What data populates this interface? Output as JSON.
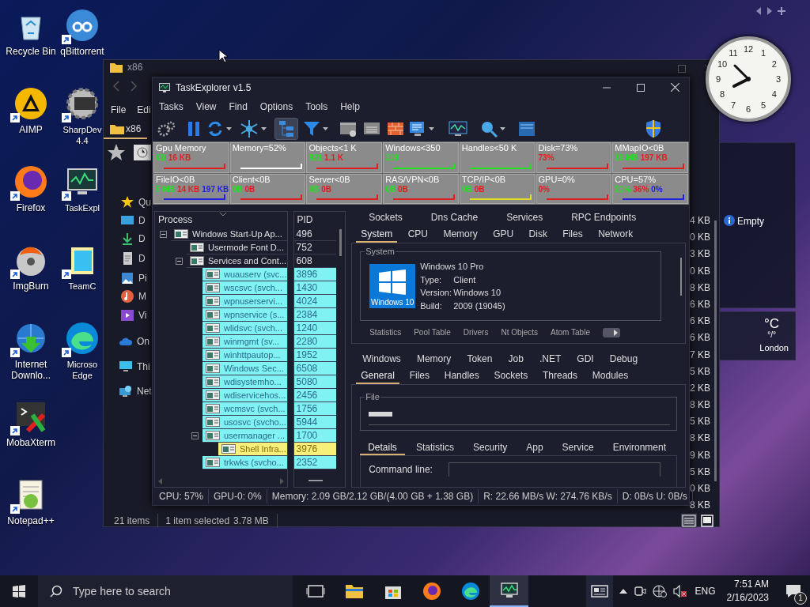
{
  "desktop_icons": [
    {
      "label": "Recycle Bin",
      "kind": "recycle",
      "shortcut": false
    },
    {
      "label": "AIMP",
      "kind": "aimp",
      "shortcut": true
    },
    {
      "label": "Firefox",
      "kind": "firefox",
      "shortcut": true
    },
    {
      "label": "ImgBurn",
      "kind": "imgburn",
      "shortcut": true
    },
    {
      "label": "Internet Downlo...",
      "kind": "idm",
      "shortcut": true
    },
    {
      "label": "MobaXterm",
      "kind": "moba",
      "shortcut": true
    },
    {
      "label": "Notepad++",
      "kind": "notepad",
      "shortcut": true
    },
    {
      "label": "qBittorrent",
      "kind": "qbit",
      "shortcut": true
    },
    {
      "label": "SharpDev 4.4",
      "kind": "sharp",
      "shortcut": true
    },
    {
      "label": "TaskExpl",
      "kind": "taskexp",
      "shortcut": true
    },
    {
      "label": "TeamC",
      "kind": "team",
      "shortcut": true
    },
    {
      "label": "Microso Edge",
      "kind": "edge",
      "shortcut": true
    }
  ],
  "explorer": {
    "title": "x86",
    "menu": [
      "File",
      "Edi"
    ],
    "tab": "x86",
    "nav_items": [
      {
        "label": "Qu",
        "kind": "star"
      },
      {
        "label": "D",
        "kind": "desktop"
      },
      {
        "label": "D",
        "kind": "download"
      },
      {
        "label": "D",
        "kind": "document"
      },
      {
        "label": "Pi",
        "kind": "pictures"
      },
      {
        "label": "M",
        "kind": "music"
      },
      {
        "label": "Vi",
        "kind": "videos"
      },
      {
        "label": "On",
        "kind": "cloud"
      },
      {
        "label": "Thi",
        "kind": "pc"
      },
      {
        "label": "Net",
        "kind": "network"
      }
    ],
    "sizes": [
      "4 KB",
      "0 KB",
      "3 KB",
      "0 KB",
      "8 KB",
      "6 KB",
      "6 KB",
      "6 KB",
      "7 KB",
      "5 KB",
      "2 KB",
      "8 KB",
      "5 KB",
      "8 KB",
      "9 KB",
      "5 KB",
      "0 KB",
      "8 KB"
    ],
    "status": {
      "count": "21 items",
      "selection": "1 item selected",
      "size": "3.78 MB"
    }
  },
  "task_explorer": {
    "title": "TaskExplorer v1.5",
    "menu": [
      "Tasks",
      "View",
      "Find",
      "Options",
      "Tools",
      "Help"
    ],
    "toolbar": {
      "tree_view_pressed": true
    },
    "graphs": [
      {
        "title": "Gpu Memory",
        "color": "#e02020",
        "values": [
          {
            "text": "0B",
            "color": "#20e020"
          },
          {
            "text": "16 KB",
            "color": "#e02020"
          }
        ]
      },
      {
        "title": "Memory=52%",
        "color": "#ffffff"
      },
      {
        "title": "Objects<1 K",
        "color": "#e02020",
        "values": [
          {
            "text": "921",
            "color": "#20e020"
          },
          {
            "text": "1.1 K",
            "color": "#e02020"
          }
        ]
      },
      {
        "title": "Windows<350",
        "color": "#20e020",
        "values": [
          {
            "text": "319",
            "color": "#20e020"
          }
        ]
      },
      {
        "title": "Handles<50 K",
        "color": "#20e020"
      },
      {
        "title": "Disk=73%",
        "color": "#e02020",
        "values": [
          {
            "text": "73%",
            "color": "#e02020"
          }
        ]
      },
      {
        "title": "MMapIO<0B",
        "color": "#e02020",
        "values": [
          {
            "text": "16 MB",
            "color": "#20e020"
          },
          {
            "text": "197 KB",
            "color": "#e02020"
          }
        ]
      },
      {
        "title": "FileIO<0B",
        "color": "#2020e0",
        "values": [
          {
            "text": "5 MB",
            "color": "#20e020"
          },
          {
            "text": "14 KB",
            "color": "#e02020"
          },
          {
            "text": "197 KB",
            "color": "#2020e0"
          }
        ]
      },
      {
        "title": "Client<0B",
        "color": "#e02020",
        "values": [
          {
            "text": "0B",
            "color": "#20e020"
          },
          {
            "text": "0B",
            "color": "#e02020"
          }
        ]
      },
      {
        "title": "Server<0B",
        "color": "#e02020",
        "values": [
          {
            "text": "0B",
            "color": "#20e020"
          },
          {
            "text": "0B",
            "color": "#e02020"
          }
        ]
      },
      {
        "title": "RAS/VPN<0B",
        "color": "#e02020",
        "values": [
          {
            "text": "0B",
            "color": "#20e020"
          },
          {
            "text": "0B",
            "color": "#e02020"
          }
        ]
      },
      {
        "title": "TCP/IP<0B",
        "color": "#e0e020",
        "values": [
          {
            "text": "0B",
            "color": "#20e020"
          },
          {
            "text": "0B",
            "color": "#e02020"
          }
        ]
      },
      {
        "title": "GPU=0%",
        "color": "#e02020",
        "values": [
          {
            "text": "0%",
            "color": "#e02020"
          }
        ]
      },
      {
        "title": "CPU=57%",
        "color": "#2020e0",
        "values": [
          {
            "text": "21%",
            "color": "#20e020"
          },
          {
            "text": "36%",
            "color": "#e02020"
          },
          {
            "text": "0%",
            "color": "#2020e0"
          }
        ]
      }
    ],
    "columns": [
      "Process",
      "PID"
    ],
    "processes": [
      {
        "name": "Windows Start-Up Ap...",
        "pid": "496",
        "kind": "normal",
        "selected": false,
        "expanded": true,
        "children": [
          {
            "name": "Usermode Font D...",
            "pid": "752",
            "kind": "normal",
            "selected": false
          },
          {
            "name": "Services and Cont...",
            "pid": "608",
            "kind": "normal",
            "selected": false,
            "expanded": true,
            "children": [
              {
                "name": "wuauserv (svc...",
                "pid": "3896",
                "kind": "service",
                "selected": false
              },
              {
                "name": "wscsvc (svch...",
                "pid": "1430",
                "kind": "service",
                "selected": false
              },
              {
                "name": "wpnuserservi...",
                "pid": "4024",
                "kind": "service",
                "selected": false
              },
              {
                "name": "wpnservice (s...",
                "pid": "2384",
                "kind": "service",
                "selected": false
              },
              {
                "name": "wlidsvc (svch...",
                "pid": "1240",
                "kind": "service",
                "selected": false
              },
              {
                "name": "winmgmt (sv...",
                "pid": "2280",
                "kind": "service",
                "selected": false
              },
              {
                "name": "winhttpautop...",
                "pid": "1952",
                "kind": "service",
                "selected": false
              },
              {
                "name": "Windows Sec...",
                "pid": "6508",
                "kind": "service",
                "selected": false
              },
              {
                "name": "wdisystemho...",
                "pid": "5080",
                "kind": "service",
                "selected": false
              },
              {
                "name": "wdiservicehos...",
                "pid": "2456",
                "kind": "service",
                "selected": false
              },
              {
                "name": "wcmsvc (svch...",
                "pid": "1756",
                "kind": "service",
                "selected": false
              },
              {
                "name": "usosvc (svcho...",
                "pid": "5944",
                "kind": "service",
                "selected": false
              },
              {
                "name": "usermanager ...",
                "pid": "1700",
                "kind": "service",
                "selected": false,
                "expanded": true,
                "children": [
                  {
                    "name": "Shell Infra...",
                    "pid": "3976",
                    "selected": true
                  }
                ]
              },
              {
                "name": "trkwks (svcho...",
                "pid": "2352",
                "kind": "service",
                "selected": false
              }
            ]
          }
        ]
      }
    ],
    "system_tabs": [
      [
        {
          "label": "Sockets",
          "selected": false
        },
        {
          "label": "Dns Cache",
          "selected": false
        },
        {
          "label": "Services",
          "selected": false
        },
        {
          "label": "RPC Endpoints",
          "selected": false
        }
      ],
      [
        {
          "label": "System",
          "selected": true
        },
        {
          "label": "CPU",
          "selected": false
        },
        {
          "label": "Memory",
          "selected": false
        },
        {
          "label": "GPU",
          "selected": false
        },
        {
          "label": "Disk",
          "selected": false
        },
        {
          "label": "Files",
          "selected": false
        },
        {
          "label": "Network",
          "selected": false
        }
      ]
    ],
    "system": {
      "group": "System",
      "logo_text": "Windows 10",
      "edition": "Windows 10 Pro",
      "fields": [
        {
          "label": "Type:",
          "value": "Client"
        },
        {
          "label": "Version:",
          "value": "Windows 10"
        },
        {
          "label": "Build:",
          "value": "2009 (19045)"
        }
      ],
      "subtabs": [
        "Statistics",
        "Pool Table",
        "Drivers",
        "Nt Objects",
        "Atom Table"
      ]
    },
    "process_tabs": [
      [
        {
          "label": "Windows",
          "selected": false
        },
        {
          "label": "Memory",
          "selected": false
        },
        {
          "label": "Token",
          "selected": false
        },
        {
          "label": "Job",
          "selected": false
        },
        {
          "label": ".NET",
          "selected": false
        },
        {
          "label": "GDI",
          "selected": false
        },
        {
          "label": "Debug",
          "selected": false
        }
      ],
      [
        {
          "label": "General",
          "selected": true
        },
        {
          "label": "Files",
          "selected": false
        },
        {
          "label": "Handles",
          "selected": false
        },
        {
          "label": "Sockets",
          "selected": false
        },
        {
          "label": "Threads",
          "selected": false
        },
        {
          "label": "Modules",
          "selected": false
        }
      ]
    ],
    "file_group": "File",
    "detail_tabs": [
      {
        "label": "Details",
        "selected": true
      },
      {
        "label": "Statistics",
        "selected": false
      },
      {
        "label": "Security",
        "selected": false
      },
      {
        "label": "App",
        "selected": false
      },
      {
        "label": "Service",
        "selected": false
      },
      {
        "label": "Environment",
        "selected": false
      }
    ],
    "command_line_label": "Command line:",
    "status": [
      "CPU: 57%",
      "GPU-0: 0%",
      "Memory: 2.09 GB/2.12 GB/(4.00 GB + 1.38 GB)",
      "R: 22.66 MB/s W: 274.76 KB/s",
      "D: 0B/s U: 0B/s"
    ]
  },
  "clock_numerals": [
    "12",
    "1",
    "2",
    "3",
    "4",
    "5",
    "6",
    "7",
    "8",
    "9",
    "10",
    "11"
  ],
  "gadget_panel": {
    "text": "Empty"
  },
  "weather": {
    "temperature": "°C",
    "range": "°/°",
    "city": "London"
  },
  "taskbar": {
    "search_placeholder": "Type here to search",
    "language": "ENG",
    "time": "7:51 AM",
    "date": "2/16/2023",
    "notifications": "1",
    "volume_muted": true
  }
}
